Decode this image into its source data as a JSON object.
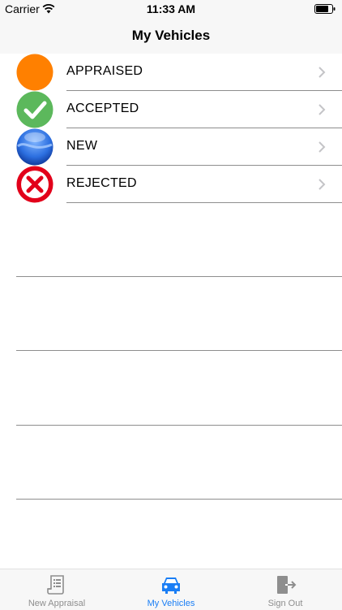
{
  "status_bar": {
    "carrier": "Carrier",
    "time": "11:33 AM"
  },
  "nav": {
    "title": "My Vehicles"
  },
  "vehicles": [
    {
      "label": "APPRAISED",
      "icon": "orange-circle-icon",
      "color": "#ff8000"
    },
    {
      "label": "ACCEPTED",
      "icon": "green-check-icon",
      "color": "#5cb85c"
    },
    {
      "label": "NEW",
      "icon": "blue-orb-icon",
      "color": "#1a5fd0"
    },
    {
      "label": "REJECTED",
      "icon": "red-x-icon",
      "color": "#e2001a"
    }
  ],
  "tabs": [
    {
      "label": "New Appraisal",
      "icon": "document-icon",
      "active": false
    },
    {
      "label": "My Vehicles",
      "icon": "car-icon",
      "active": true
    },
    {
      "label": "Sign Out",
      "icon": "sign-out-icon",
      "active": false
    }
  ],
  "colors": {
    "accent": "#1a7ef5",
    "inactive": "#8e8e8e"
  }
}
